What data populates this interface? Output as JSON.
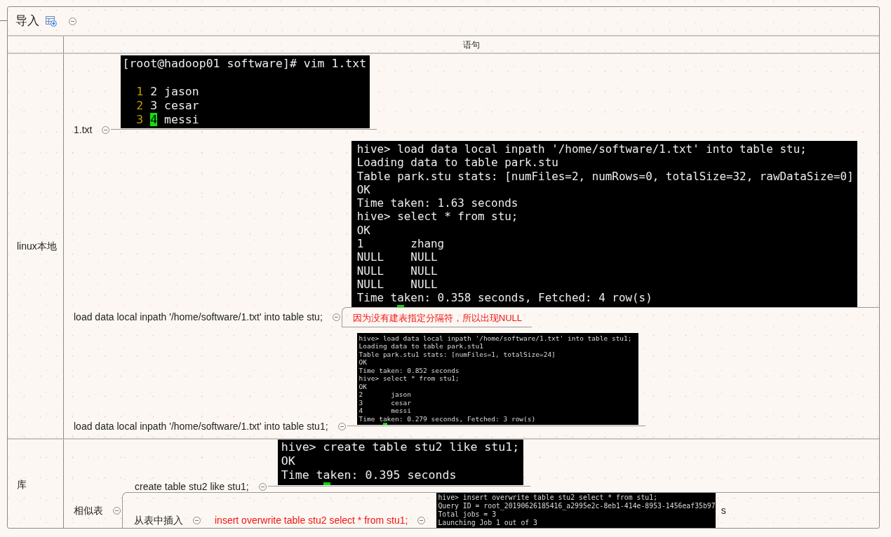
{
  "header": {
    "title": "导入",
    "expanded": true
  },
  "table": {
    "heading": "语句",
    "rows": [
      {
        "label": "linux本地",
        "items": [
          {
            "kind": "topic",
            "text": "1.txt",
            "expanded": true,
            "children": [
              {
                "kind": "editor",
                "command": "[root@hadoop01 software]# vim 1.txt",
                "lines": [
                  {
                    "number": "1",
                    "text": "2 jason",
                    "cursor": false
                  },
                  {
                    "number": "2",
                    "text": "3 cesar",
                    "cursor": false
                  },
                  {
                    "number": "3",
                    "text": "4 messi",
                    "cursor": true
                  }
                ]
              }
            ]
          },
          {
            "kind": "topic",
            "text": "load data local inpath '/home/software/1.txt' into table stu;",
            "expanded": true,
            "children": [
              {
                "kind": "terminal",
                "cursor": true,
                "lines": [
                  "hive> load data local inpath '/home/software/1.txt' into table stu;",
                  "Loading data to table park.stu",
                  "Table park.stu stats: [numFiles=2, numRows=0, totalSize=32, rawDataSize=0]",
                  "OK",
                  "Time taken: 1.63 seconds",
                  "hive> select * from stu;",
                  "OK",
                  "1       zhang",
                  "NULL    NULL",
                  "NULL    NULL",
                  "NULL    NULL",
                  "Time taken: 0.358 seconds, Fetched: 4 row(s)"
                ]
              },
              {
                "kind": "note",
                "text": "因为没有建表指定分隔符，所以出现NULL"
              }
            ]
          },
          {
            "kind": "topic",
            "text": "load data local inpath '/home/software/1.txt' into table stu1;",
            "expanded": true,
            "children": [
              {
                "kind": "terminal",
                "cursor": true,
                "lines": [
                  "hive> load data local inpath '/home/software/1.txt' into table stu1;",
                  "Loading data to table park.stu1",
                  "Table park.stu1 stats: [numFiles=1, totalSize=24]",
                  "OK",
                  "Time taken: 0.852 seconds",
                  "hive> select * from stu1;",
                  "OK",
                  "2       jason",
                  "3       cesar",
                  "4       messi",
                  "Time taken: 0.279 seconds, Fetched: 3 row(s)"
                ]
              }
            ]
          }
        ]
      },
      {
        "label": "库",
        "items": [
          {
            "kind": "topic",
            "text": "相似表",
            "expanded": true,
            "children": [
              {
                "kind": "topic",
                "text": "create table stu2 like stu1;",
                "expanded": true,
                "children": [
                  {
                    "kind": "terminal",
                    "cursor": true,
                    "lines": [
                      "hive> create table stu2 like stu1;",
                      "OK",
                      "Time taken: 0.395 seconds"
                    ]
                  }
                ]
              },
              {
                "kind": "topic",
                "text": "从表中插入",
                "expanded": true,
                "children": [
                  {
                    "kind": "command",
                    "text": "insert overwrite table stu2 select * from stu1;",
                    "expanded": true,
                    "children": [
                      {
                        "kind": "terminal",
                        "cursor": false,
                        "suffix": "s",
                        "lines": [
                          "hive> insert overwrite table stu2 select * from stu1;",
                          "Query ID = root_20190626185416_a2995e2c-8eb1-414e-8953-1456eaf35b97",
                          "Total jobs = 3",
                          "Launching Job 1 out of 3"
                        ]
                      }
                    ]
                  }
                ]
              }
            ]
          }
        ]
      }
    ]
  }
}
